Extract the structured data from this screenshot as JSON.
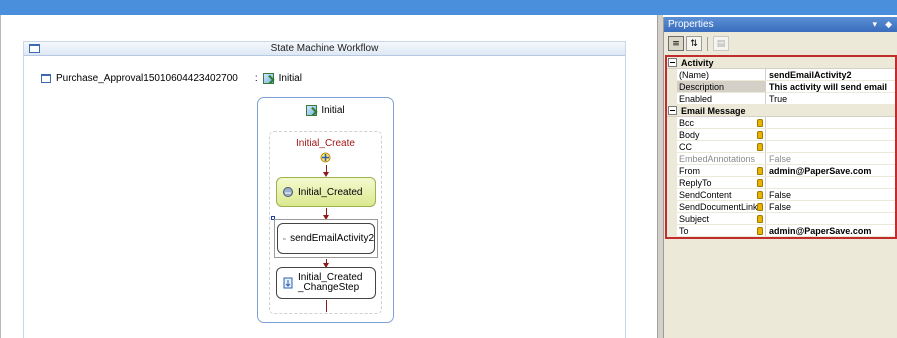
{
  "designer": {
    "title": "State Machine Workflow",
    "workflow_name": "Purchase_Approval15010604423402700",
    "workflow_separator": ":",
    "initial_state_link": "Initial",
    "state": {
      "title": "Initial",
      "sequence_title": "Initial_Create",
      "activities": [
        {
          "label": "Initial_Created"
        },
        {
          "label": "sendEmailActivity2"
        },
        {
          "label": "Initial_Created_ChangeStep"
        }
      ]
    }
  },
  "properties": {
    "title": "Properties",
    "pin_glyph": "▾",
    "pin2_glyph": "◆",
    "toolbar": {
      "categorized_glyph": "≡",
      "alphabetical_glyph": "⇅",
      "pages_glyph": "▤"
    },
    "categories": [
      {
        "name": "Activity",
        "rows": [
          {
            "name": "(Name)",
            "value": "sendEmailActivity2",
            "bold": true,
            "badge": false,
            "muted": false
          },
          {
            "name": "Description",
            "value": "This activity will send email",
            "bold": true,
            "badge": false,
            "muted": false
          },
          {
            "name": "Enabled",
            "value": "True",
            "bold": false,
            "badge": false,
            "muted": false
          }
        ]
      },
      {
        "name": "Email Message",
        "rows": [
          {
            "name": "Bcc",
            "value": "",
            "bold": false,
            "badge": true,
            "muted": false
          },
          {
            "name": "Body",
            "value": "",
            "bold": false,
            "badge": true,
            "muted": false
          },
          {
            "name": "CC",
            "value": "",
            "bold": false,
            "badge": true,
            "muted": false
          },
          {
            "name": "EmbedAnnotations",
            "value": "False",
            "bold": false,
            "badge": false,
            "muted": true
          },
          {
            "name": "From",
            "value": "admin@PaperSave.com",
            "bold": true,
            "badge": true,
            "muted": false
          },
          {
            "name": "ReplyTo",
            "value": "",
            "bold": false,
            "badge": true,
            "muted": false
          },
          {
            "name": "SendContent",
            "value": "False",
            "bold": false,
            "badge": true,
            "muted": false
          },
          {
            "name": "SendDocumentLink",
            "value": "False",
            "bold": false,
            "badge": true,
            "muted": false
          },
          {
            "name": "Subject",
            "value": "",
            "bold": false,
            "badge": true,
            "muted": false
          },
          {
            "name": "To",
            "value": "admin@PaperSave.com",
            "bold": true,
            "badge": true,
            "muted": false
          }
        ]
      }
    ]
  }
}
